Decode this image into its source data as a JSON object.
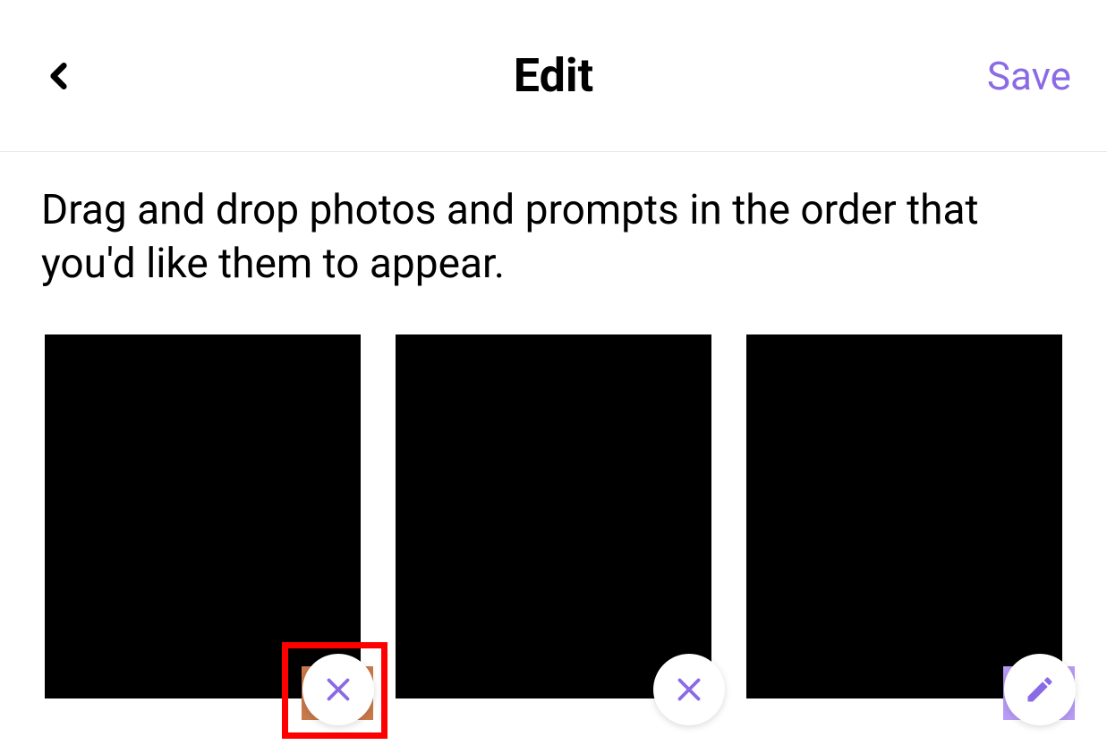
{
  "header": {
    "title": "Edit",
    "save_label": "Save"
  },
  "instructions": "Drag and drop photos and prompts in the order that you'd like them to appear.",
  "cards": [
    {
      "action": "close",
      "highlighted": true,
      "bg_tint": "orange"
    },
    {
      "action": "close",
      "highlighted": false,
      "bg_tint": null
    },
    {
      "action": "edit",
      "highlighted": false,
      "bg_tint": "purple"
    }
  ],
  "colors": {
    "accent": "#8b6ae6",
    "highlight": "#ff0000"
  }
}
